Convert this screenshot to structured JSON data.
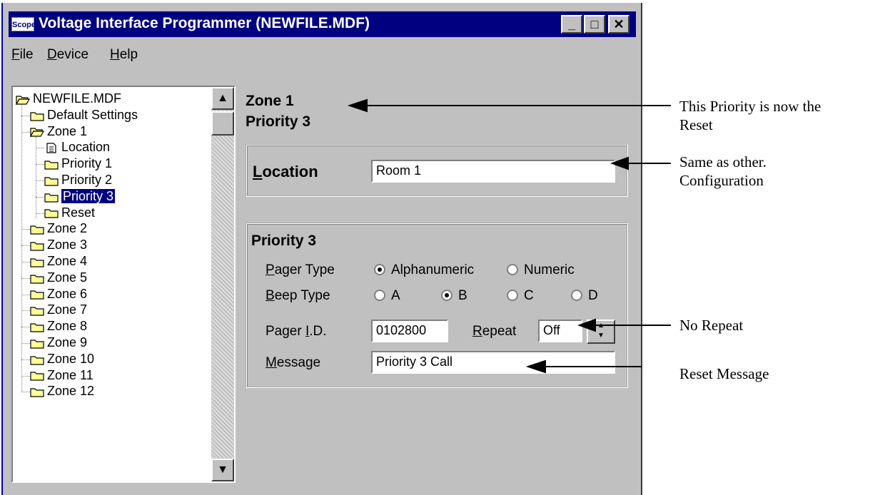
{
  "window": {
    "title": "Voltage Interface Programmer (NEWFILE.MDF)",
    "app_icon_text": "Scope",
    "controls": {
      "minimize": "_",
      "maximize": "□",
      "close": "✕"
    }
  },
  "menu": [
    {
      "label": "File",
      "mnemonic": "F",
      "rest": "ile"
    },
    {
      "label": "Device",
      "mnemonic": "D",
      "rest": "evice"
    },
    {
      "label": "Help",
      "mnemonic": "H",
      "rest": "elp"
    }
  ],
  "tree": {
    "root": "NEWFILE.MDF",
    "items": [
      {
        "label": "Default Settings"
      },
      {
        "label": "Zone 1"
      },
      {
        "label": "Location"
      },
      {
        "label": "Priority 1"
      },
      {
        "label": "Priority 2"
      },
      {
        "label": "Priority 3"
      },
      {
        "label": "Reset"
      },
      {
        "label": "Zone 2"
      },
      {
        "label": "Zone 3"
      },
      {
        "label": "Zone 4"
      },
      {
        "label": "Zone 5"
      },
      {
        "label": "Zone 6"
      },
      {
        "label": "Zone 7"
      },
      {
        "label": "Zone 8"
      },
      {
        "label": "Zone 9"
      },
      {
        "label": "Zone 10"
      },
      {
        "label": "Zone 11"
      },
      {
        "label": "Zone 12"
      }
    ],
    "selected": "Priority 3"
  },
  "panel": {
    "heading_zone": "Zone 1",
    "heading_priority": "Priority 3",
    "location": {
      "label": "Location",
      "value": "Room 1"
    },
    "priority_group": {
      "title": "Priority 3",
      "pager_type": {
        "label": "Pager Type",
        "options": [
          "Alphanumeric",
          "Numeric"
        ],
        "selected": "Alphanumeric"
      },
      "beep_type": {
        "label": "Beep Type",
        "options": [
          "A",
          "B",
          "C",
          "D"
        ],
        "selected": "B"
      },
      "pager_id": {
        "label": "Pager I.D.",
        "value": "0102800"
      },
      "repeat": {
        "label": "Repeat",
        "value": "Off"
      },
      "message": {
        "label": "Message",
        "value": "Priority 3 Call"
      }
    }
  },
  "annotations": {
    "a1_line1": "This Priority is now the",
    "a1_line2": "Reset",
    "a1_line3": "Same as other.",
    "a1_line4": "Configuration",
    "a2": "No Repeat",
    "a3": "Reset Message"
  }
}
